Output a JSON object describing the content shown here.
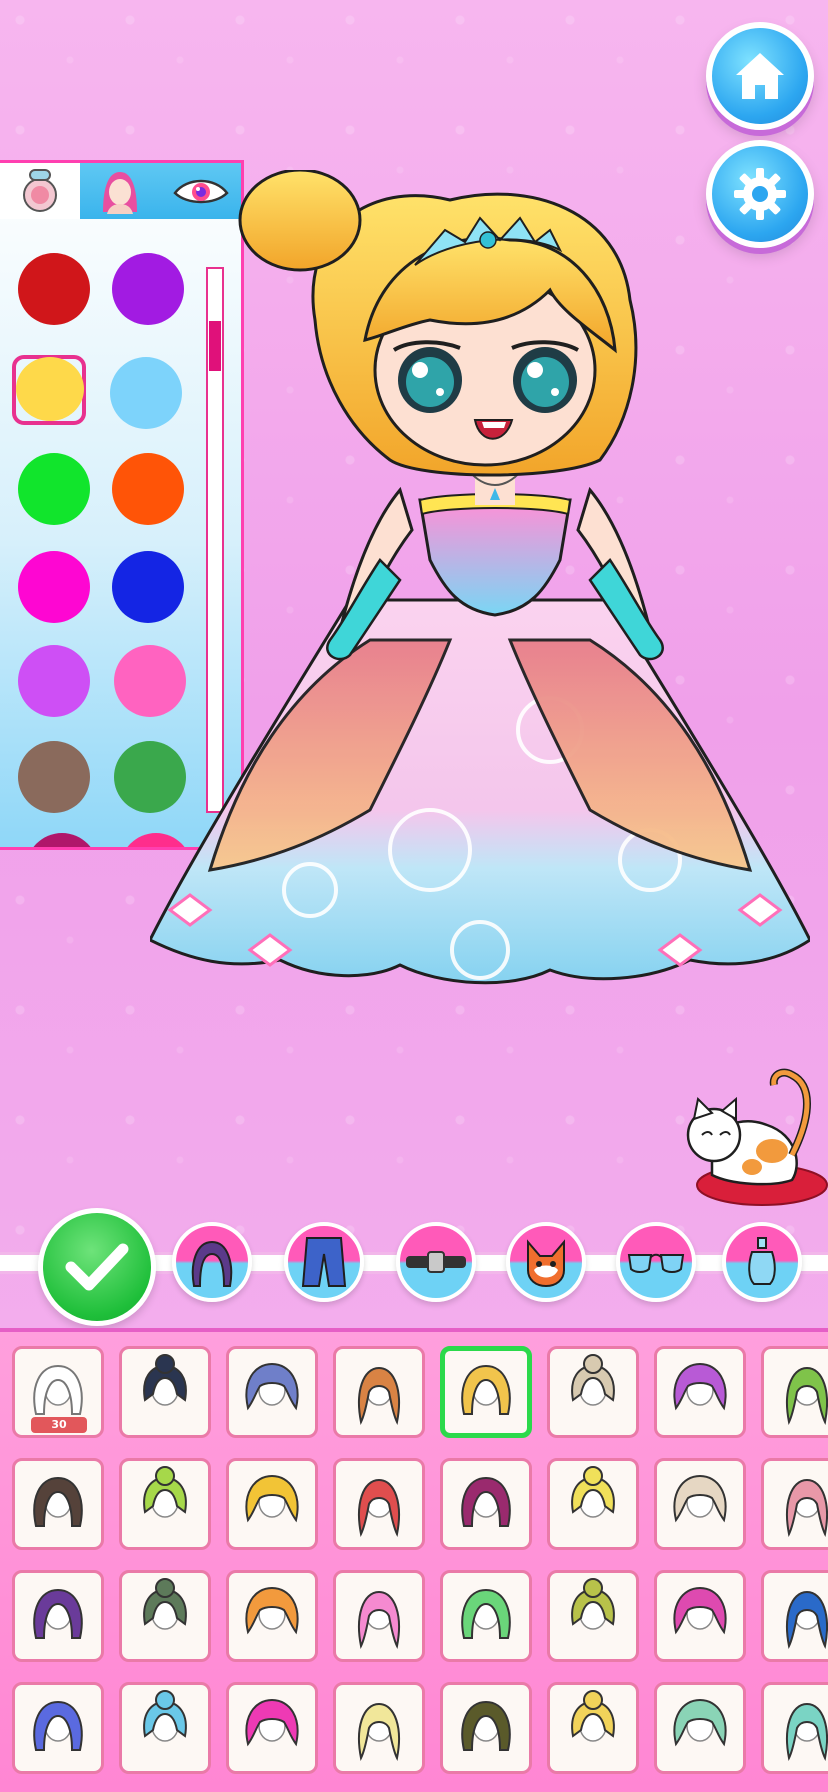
{
  "controls": {
    "home_icon": "home-icon",
    "settings_icon": "gear-icon",
    "confirm_icon": "checkmark-icon"
  },
  "palette": {
    "tabs": [
      {
        "icon": "makeup-compact-icon",
        "active": true
      },
      {
        "icon": "face-skin-icon",
        "active": false
      },
      {
        "icon": "eye-color-icon",
        "active": false
      }
    ],
    "colors": [
      "#d0161a",
      "#a21be2",
      "#fed94a",
      "#7dd3fb",
      "#11e52c",
      "#ff5407",
      "#fe06d2",
      "#1425e4",
      "#ce4ff5",
      "#ff63c0",
      "#8a6a5c",
      "#3aa84c",
      "#b0166a",
      "#ff2d8c"
    ],
    "selected_color": "#fed94a",
    "brightness_slider_level": 0.1
  },
  "categories": [
    {
      "icon": "hair-icon"
    },
    {
      "icon": "pants-icon"
    },
    {
      "icon": "belt-icon"
    },
    {
      "icon": "fox-pet-icon"
    },
    {
      "icon": "sunglasses-icon"
    },
    {
      "icon": "perfume-bottle-icon"
    }
  ],
  "items": {
    "price_label": "30",
    "selected_index": 4,
    "hair_colors": [
      "#ffffff",
      "#2a3550",
      "#6f7fc9",
      "#d98344",
      "#f1c44c",
      "#d8cab0",
      "#b85ad6",
      "#7fc34a",
      "#55423a",
      "#a6d84a",
      "#f2c436",
      "#e04e4e",
      "#9a2a6e",
      "#f0e05a",
      "#e6d7c3",
      "#e898a8",
      "#6a3b9a",
      "#5d7a5a",
      "#f29a3d",
      "#f58ad0",
      "#6ad67a",
      "#b8c24a",
      "#de4ab0",
      "#2a6ac9",
      "#5a6ae0",
      "#6ac8e8",
      "#ee3ab4",
      "#f1e79a",
      "#5a5a2a",
      "#f1d35a",
      "#8ad4b6",
      "#7ad4c4"
    ]
  }
}
